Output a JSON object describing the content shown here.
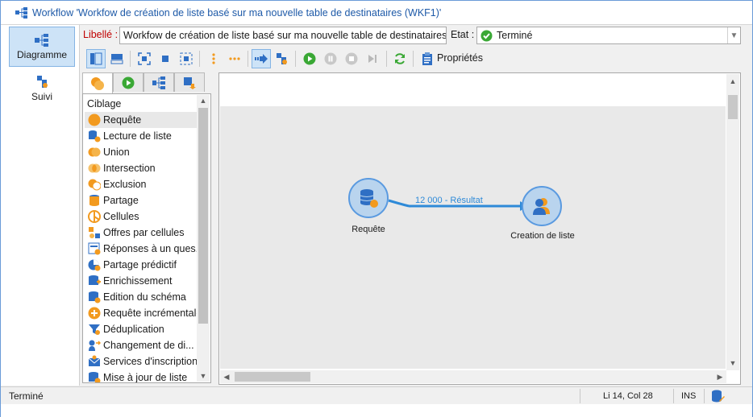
{
  "window": {
    "title": "Workflow 'Workfow de création de liste basé sur ma nouvelle table de destinataires (WKF1)'"
  },
  "left_tabs": [
    {
      "label": "Diagramme",
      "active": true,
      "icon": "diagram-icon"
    },
    {
      "label": "Suivi",
      "active": false,
      "icon": "tracking-icon"
    }
  ],
  "form": {
    "label_caption": "Libellé :",
    "label_value": "Workfow de création de liste basé sur ma nouvelle table de destinataires",
    "status_caption": "Etat :",
    "status_value": "Terminé"
  },
  "toolbar": {
    "properties_label": "Propriétés"
  },
  "palette": {
    "tabs": [
      "targeting-tab-icon",
      "flow-control-tab-icon",
      "actions-tab-icon",
      "events-tab-icon"
    ],
    "category": "Ciblage",
    "items": [
      {
        "label": "Requête",
        "icon": "query-icon"
      },
      {
        "label": "Lecture de liste",
        "icon": "list-read-icon"
      },
      {
        "label": "Union",
        "icon": "union-icon"
      },
      {
        "label": "Intersection",
        "icon": "intersection-icon"
      },
      {
        "label": "Exclusion",
        "icon": "exclusion-icon"
      },
      {
        "label": "Partage",
        "icon": "split-icon"
      },
      {
        "label": "Cellules",
        "icon": "cells-icon"
      },
      {
        "label": "Offres par cellules",
        "icon": "offers-icon"
      },
      {
        "label": "Réponses à un ques...",
        "icon": "survey-responses-icon"
      },
      {
        "label": "Partage prédictif",
        "icon": "predictive-split-icon"
      },
      {
        "label": "Enrichissement",
        "icon": "enrichment-icon"
      },
      {
        "label": "Edition du schéma",
        "icon": "schema-edit-icon"
      },
      {
        "label": "Requête incrémentale",
        "icon": "incremental-query-icon"
      },
      {
        "label": "Déduplication",
        "icon": "deduplication-icon"
      },
      {
        "label": "Changement de di...",
        "icon": "dimension-change-icon"
      },
      {
        "label": "Services d'inscriptions",
        "icon": "subscription-services-icon"
      },
      {
        "label": "Mise à jour de liste",
        "icon": "list-update-icon"
      }
    ]
  },
  "diagram": {
    "nodes": [
      {
        "label": "Requête",
        "icon": "query-node-icon"
      },
      {
        "label": "Creation de liste",
        "icon": "list-creation-node-icon"
      }
    ],
    "transition_label": "12 000 - Résultat"
  },
  "statusbar": {
    "state": "Terminé",
    "position": "Li 14, Col 28",
    "mode": "INS"
  },
  "colors": {
    "accent": "#1e5aa8",
    "node_fill": "#b9d4ee",
    "node_border": "#5a9ae0",
    "transition": "#2e8ad8",
    "orange": "#f29a1f",
    "green": "#3aa835"
  }
}
